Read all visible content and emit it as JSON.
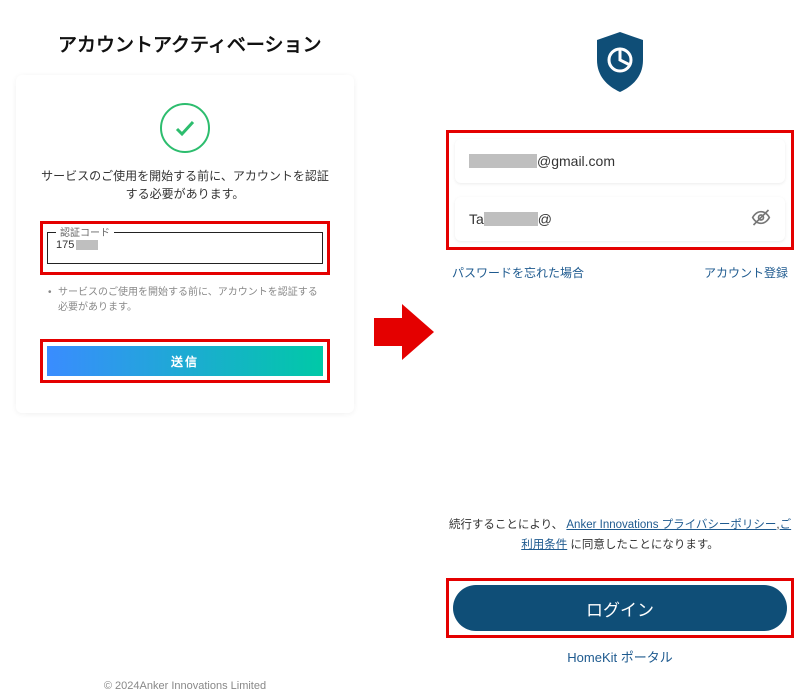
{
  "left": {
    "title": "アカウントアクティベーション",
    "message": "サービスのご使用を開始する前に、アカウントを認証する必要があります。",
    "code_label": "認証コード",
    "code_prefix": "175",
    "note": "サービスのご使用を開始する前に、アカウントを認証する必要があります。",
    "submit": "送信"
  },
  "right": {
    "email_suffix": "@gmail.com",
    "pw_prefix": "Ta",
    "pw_at": "@",
    "forgot": "パスワードを忘れた場合",
    "signup": "アカウント登録",
    "consent_pre": "続行することにより、 ",
    "consent_link1": "Anker Innovations プライバシーポリシー",
    "consent_sep": ",",
    "consent_link2": "ご利用条件",
    "consent_post": " に同意したことになります。",
    "login": "ログイン",
    "homekit": "HomeKit ポータル"
  },
  "footer": {
    "copyright": "© 2024Anker Innovations Limited"
  }
}
